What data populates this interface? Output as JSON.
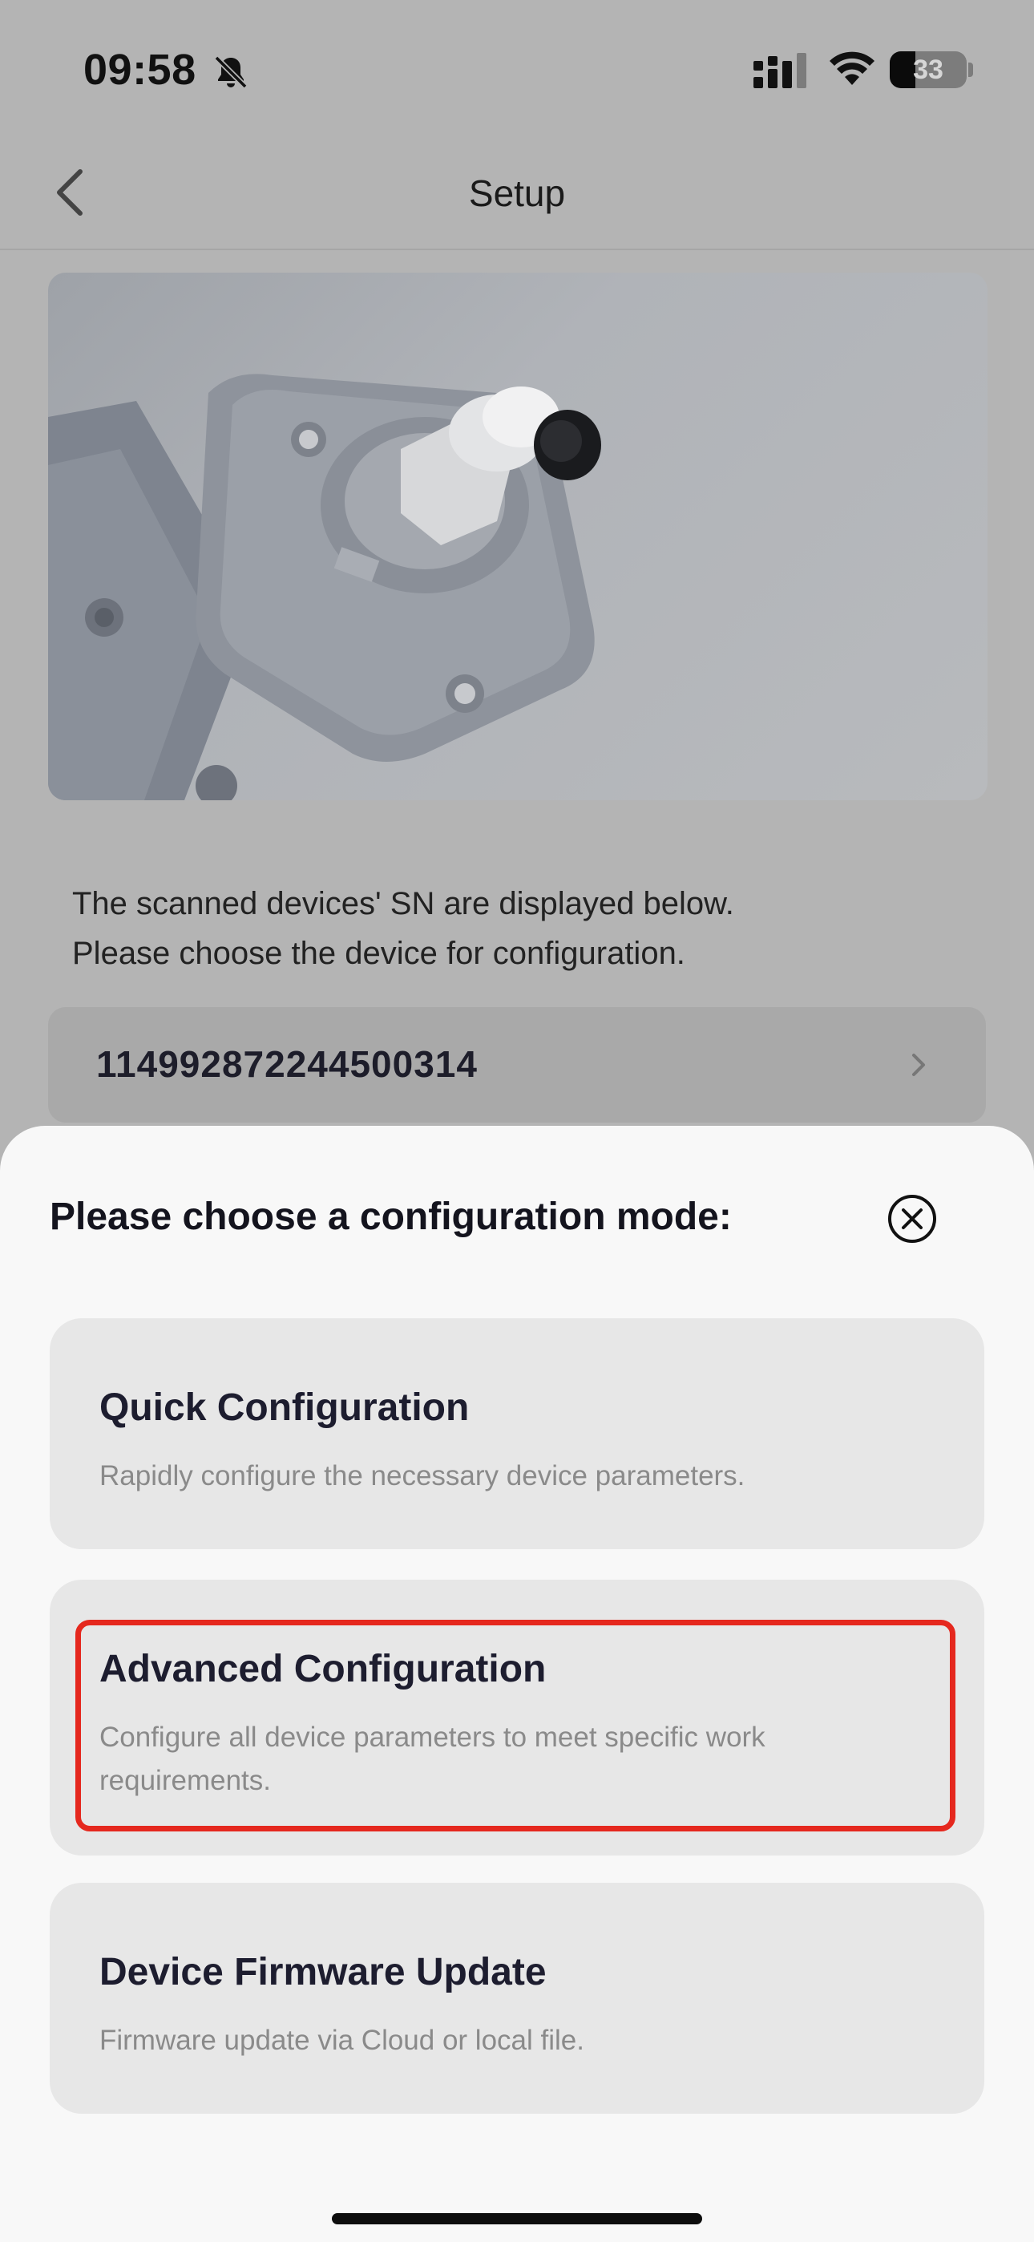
{
  "status_bar": {
    "time": "09:58",
    "battery": "33",
    "battery_level": 0.33
  },
  "nav": {
    "title": "Setup"
  },
  "instruction": {
    "line1": "The scanned devices' SN are displayed below.",
    "line2": "Please choose the device for configuration."
  },
  "device": {
    "sn": "114992872244500314"
  },
  "sheet": {
    "title": "Please choose a configuration mode:",
    "options": [
      {
        "title": "Quick Configuration",
        "description": "Rapidly configure the necessary device parameters."
      },
      {
        "title": "Advanced Configuration",
        "description": "Configure all device parameters to meet specific work requirements."
      },
      {
        "title": "Device Firmware Update",
        "description": "Firmware update via Cloud or local file."
      }
    ]
  },
  "colors": {
    "highlight": "#e5281e",
    "sheet_background": "#f8f8f8",
    "option_background": "#e7e7e7"
  }
}
